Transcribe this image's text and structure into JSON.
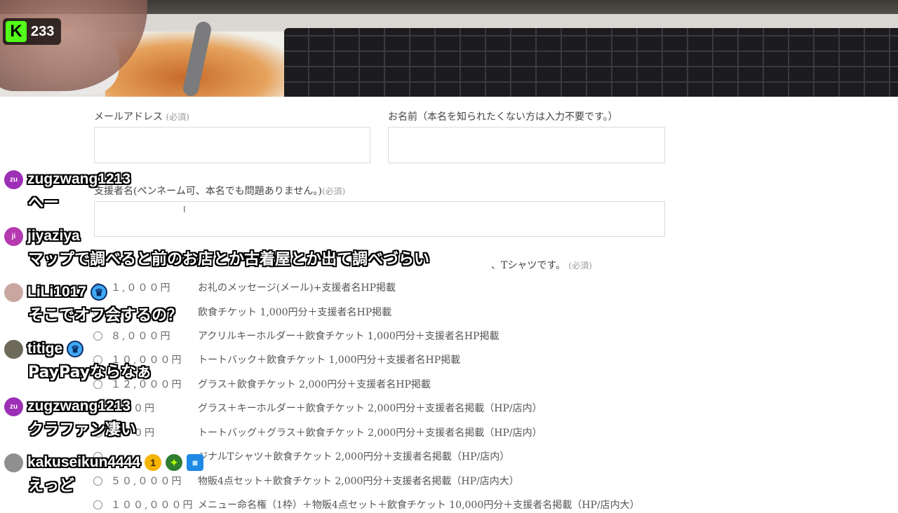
{
  "stream": {
    "viewer_icon": "K",
    "viewer_count": "233"
  },
  "form": {
    "email_label": "メールアドレス",
    "email_req": "(必須)",
    "name_label": "お名前（本名を知られたくない方は入力不要です。）",
    "supporter_label": "支援者名(ペンネーム可、本名でも問題ありません。)",
    "supporter_req": "(必須)",
    "plan_label_end": "、Tシャツです。",
    "plan_req": "(必須)",
    "plans": [
      {
        "price": "１,０００円",
        "desc": "お礼のメッセージ(メール)+支援者名HP掲載"
      },
      {
        "price": "",
        "desc": "飲食チケット 1,000円分＋支援者名HP掲載"
      },
      {
        "price": "８,０００円",
        "desc": "アクリルキーホルダー＋飲食チケット 1,000円分＋支援者名HP掲載"
      },
      {
        "price": "１０,０００円",
        "desc": "トートバック＋飲食チケット 1,000円分＋支援者名HP掲載"
      },
      {
        "price": "１２,０００円",
        "desc": "グラス＋飲食チケット 2,000円分＋支援者名HP掲載"
      },
      {
        "price": "０００円",
        "desc": "グラス＋キーホルダー＋飲食チケット 2,000円分＋支援者名掲載（HP/店内）"
      },
      {
        "price": "０００円",
        "desc": "トートバッグ＋グラス＋飲食チケット 2,000円分＋支援者名掲載（HP/店内）"
      },
      {
        "price": "",
        "desc": "ジナルTシャツ＋飲食チケット 2,000円分＋支援者名掲載（HP/店内）"
      },
      {
        "price": "５０,０００円",
        "desc": "物販4点セット＋飲食チケット 2,000円分＋支援者名掲載（HP/店内大）"
      },
      {
        "price": "１００,０００円",
        "desc": "メニュー命名権（1枠）＋物販4点セット＋飲食チケット 10,000円分＋支援者名掲載（HP/店内大）"
      }
    ]
  },
  "chat": [
    {
      "avatar": "zu",
      "avatar_color": "#9c2fb5",
      "name": "zugzwang1213",
      "badges": [],
      "text": "へー"
    },
    {
      "avatar": "ji",
      "avatar_color": "#b53ab0",
      "name": "jiyaziya",
      "badges": [],
      "text": "マップで調べると前のお店とか古着屋とか出て調べづらい"
    },
    {
      "avatar": "",
      "avatar_color": "#c9a7a0",
      "name": "LiLi1017",
      "badges": [
        "crown"
      ],
      "text": "そこでオフ会するの？"
    },
    {
      "avatar": "",
      "avatar_color": "#6d6a5a",
      "name": "titige",
      "badges": [
        "crown"
      ],
      "text": "PayPayならなぁ"
    },
    {
      "avatar": "zu",
      "avatar_color": "#9c2fb5",
      "name": "zugzwang1213",
      "badges": [],
      "text": "クラファン凄い"
    },
    {
      "avatar": "",
      "avatar_color": "#8f8f8f",
      "name": "kakuseikun4444",
      "badges": [
        "one",
        "spark",
        "cube"
      ],
      "text": "えっど"
    }
  ],
  "colors": {
    "kick_green": "#53fc18"
  }
}
